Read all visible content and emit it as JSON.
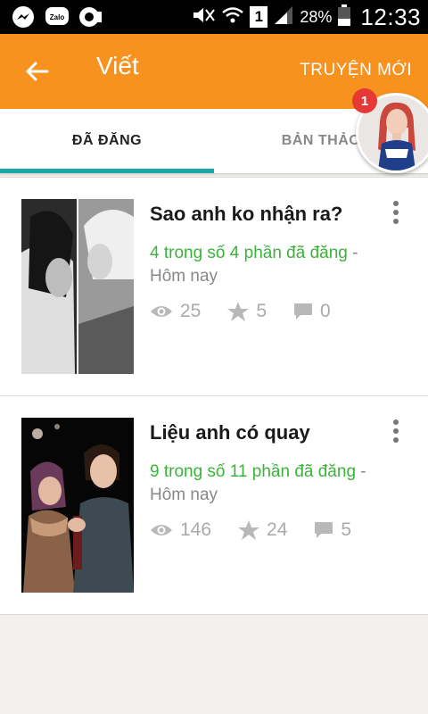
{
  "status_bar": {
    "battery_percent": "28%",
    "time": "12:33",
    "sim_label": "1",
    "notification_icons": [
      "messenger-icon",
      "zalo-icon",
      "video-icon"
    ]
  },
  "app_bar": {
    "title": "Viết",
    "new_story_label": "TRUYỆN MỚI",
    "accent_color": "#f7921e"
  },
  "tabs": [
    {
      "label": "ĐÃ ĐĂNG",
      "active": true
    },
    {
      "label": "BẢN THẢO",
      "active": false
    }
  ],
  "avatar": {
    "badge_count": "1"
  },
  "stories": [
    {
      "title": "Sao anh ko nhận ra?",
      "parts": "4 trong số 4 phần đã đăng",
      "separator": " -",
      "updated": "Hôm nay",
      "views": "25",
      "votes": "5",
      "comments": "0"
    },
    {
      "title": "Liệu anh có quay",
      "parts": "9 trong số 11 phần đã đăng",
      "separator": " -",
      "updated": "Hôm nay",
      "views": "146",
      "votes": "24",
      "comments": "5"
    }
  ]
}
